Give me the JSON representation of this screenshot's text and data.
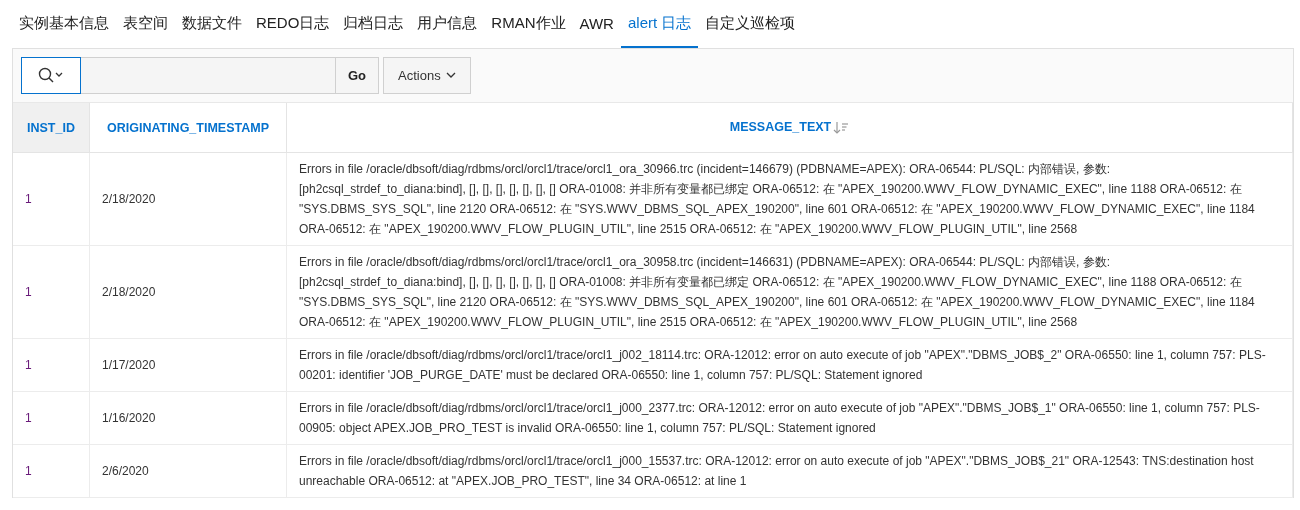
{
  "tabs": [
    {
      "label": "实例基本信息",
      "selected": false
    },
    {
      "label": "表空间",
      "selected": false
    },
    {
      "label": "数据文件",
      "selected": false
    },
    {
      "label": "REDO日志",
      "selected": false
    },
    {
      "label": "归档日志",
      "selected": false
    },
    {
      "label": "用户信息",
      "selected": false
    },
    {
      "label": "RMAN作业",
      "selected": false
    },
    {
      "label": "AWR",
      "selected": false
    },
    {
      "label": "alert 日志",
      "selected": true
    },
    {
      "label": "自定义巡检项",
      "selected": false
    }
  ],
  "toolbar": {
    "go_button": "Go",
    "actions_button": "Actions"
  },
  "table": {
    "columns": [
      {
        "label": "INST_ID",
        "sorted": false
      },
      {
        "label": "ORIGINATING_TIMESTAMP",
        "sorted": false
      },
      {
        "label": "MESSAGE_TEXT",
        "sorted": true
      }
    ],
    "rows": [
      {
        "inst_id": "1",
        "timestamp": "2/18/2020",
        "message": "Errors in file /oracle/dbsoft/diag/rdbms/orcl/orcl1/trace/orcl1_ora_30966.trc (incident=146679) (PDBNAME=APEX): ORA-06544: PL/SQL: 内部错误, 参数: [ph2csql_strdef_to_diana:bind], [], [], [], [], [], [], [] ORA-01008: 并非所有变量都已绑定 ORA-06512: 在 \"APEX_190200.WWV_FLOW_DYNAMIC_EXEC\", line 1188 ORA-06512: 在 \"SYS.DBMS_SYS_SQL\", line 2120 ORA-06512: 在 \"SYS.WWV_DBMS_SQL_APEX_190200\", line 601 ORA-06512: 在 \"APEX_190200.WWV_FLOW_DYNAMIC_EXEC\", line 1184 ORA-06512: 在 \"APEX_190200.WWV_FLOW_PLUGIN_UTIL\", line 2515 ORA-06512: 在 \"APEX_190200.WWV_FLOW_PLUGIN_UTIL\", line 2568"
      },
      {
        "inst_id": "1",
        "timestamp": "2/18/2020",
        "message": "Errors in file /oracle/dbsoft/diag/rdbms/orcl/orcl1/trace/orcl1_ora_30958.trc (incident=146631) (PDBNAME=APEX): ORA-06544: PL/SQL: 内部错误, 参数: [ph2csql_strdef_to_diana:bind], [], [], [], [], [], [], [] ORA-01008: 并非所有变量都已绑定 ORA-06512: 在 \"APEX_190200.WWV_FLOW_DYNAMIC_EXEC\", line 1188 ORA-06512: 在 \"SYS.DBMS_SYS_SQL\", line 2120 ORA-06512: 在 \"SYS.WWV_DBMS_SQL_APEX_190200\", line 601 ORA-06512: 在 \"APEX_190200.WWV_FLOW_DYNAMIC_EXEC\", line 1184 ORA-06512: 在 \"APEX_190200.WWV_FLOW_PLUGIN_UTIL\", line 2515 ORA-06512: 在 \"APEX_190200.WWV_FLOW_PLUGIN_UTIL\", line 2568"
      },
      {
        "inst_id": "1",
        "timestamp": "1/17/2020",
        "message": "Errors in file /oracle/dbsoft/diag/rdbms/orcl/orcl1/trace/orcl1_j002_18114.trc: ORA-12012: error on auto execute of job \"APEX\".\"DBMS_JOB$_2\" ORA-06550: line 1, column 757: PLS-00201: identifier 'JOB_PURGE_DATE' must be declared ORA-06550: line 1, column 757: PL/SQL: Statement ignored"
      },
      {
        "inst_id": "1",
        "timestamp": "1/16/2020",
        "message": "Errors in file /oracle/dbsoft/diag/rdbms/orcl/orcl1/trace/orcl1_j000_2377.trc: ORA-12012: error on auto execute of job \"APEX\".\"DBMS_JOB$_1\" ORA-06550: line 1, column 757: PLS-00905: object APEX.JOB_PRO_TEST is invalid ORA-06550: line 1, column 757: PL/SQL: Statement ignored"
      },
      {
        "inst_id": "1",
        "timestamp": "2/6/2020",
        "message": "Errors in file /oracle/dbsoft/diag/rdbms/orcl/orcl1/trace/orcl1_j000_15537.trc: ORA-12012: error on auto execute of job \"APEX\".\"DBMS_JOB$_21\" ORA-12543: TNS:destination host unreachable ORA-06512: at \"APEX.JOB_PRO_TEST\", line 34 ORA-06512: at line 1"
      }
    ]
  }
}
